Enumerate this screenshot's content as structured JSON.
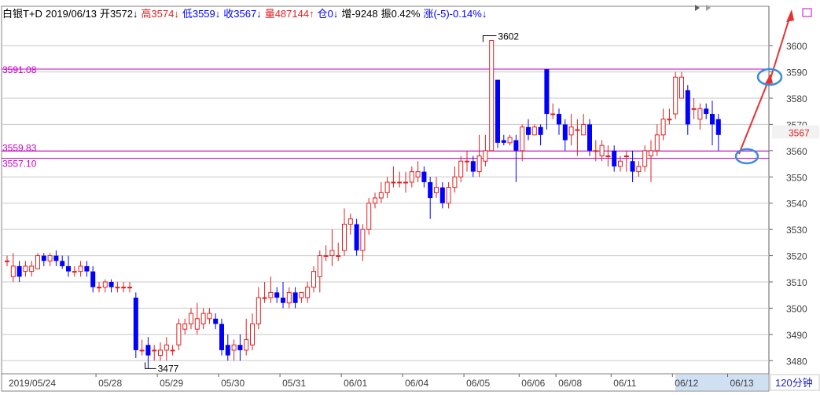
{
  "header": {
    "parts": [
      {
        "text": "白银T+D",
        "color": "#000000"
      },
      {
        "text": "2019/06/13",
        "color": "#000000"
      },
      {
        "text": "开3572↓",
        "color": "#000000"
      },
      {
        "text": "高3574↓",
        "color": "#e02020"
      },
      {
        "text": "低3559↓",
        "color": "#0000ff"
      },
      {
        "text": "收3567↓",
        "color": "#0000ff"
      },
      {
        "text": "量487144↑",
        "color": "#e02020"
      },
      {
        "text": "仓0↓",
        "color": "#0000ff"
      },
      {
        "text": "增-9248",
        "color": "#000000"
      },
      {
        "text": "振0.42%",
        "color": "#000000"
      },
      {
        "text": "涨(-5)-0.14%↓",
        "color": "#0000ff"
      }
    ]
  },
  "period_label": "120分钟",
  "colors": {
    "up": "#e02020",
    "down": "#0000ff",
    "level": "#c800c8",
    "arrow": "#e83030",
    "circle": "#3a8be0",
    "grid": "#c8c8c8",
    "axis": "#808080"
  },
  "chart_data": {
    "type": "candlestick",
    "title": "",
    "ylim": [
      3475,
      3615
    ],
    "y_ticks": [
      3480,
      3490,
      3500,
      3510,
      3520,
      3530,
      3540,
      3550,
      3560,
      3570,
      3580,
      3590,
      3600
    ],
    "x_labels": [
      {
        "label": "2019/05/24",
        "at": 0
      },
      {
        "label": "05/28",
        "at": 14.5
      },
      {
        "label": "05/29",
        "at": 24.5
      },
      {
        "label": "05/30",
        "at": 34.5
      },
      {
        "label": "05/31",
        "at": 44.5
      },
      {
        "label": "06/01",
        "at": 54.5
      },
      {
        "label": "06/04",
        "at": 64.5
      },
      {
        "label": "06/05",
        "at": 74.5
      },
      {
        "label": "06/06",
        "at": 83.5
      },
      {
        "label": "06/08",
        "at": 89.5
      },
      {
        "label": "06/11",
        "at": 98.5
      },
      {
        "label": "06/12",
        "at": 108.5
      },
      {
        "label": "06/13",
        "at": 117.5
      }
    ],
    "horizontal_levels": [
      {
        "value": 3591.08,
        "label": "3591.08"
      },
      {
        "value": 3559.83,
        "label": "3559.83"
      },
      {
        "value": 3557.1,
        "label": "3557.10"
      }
    ],
    "annotations": [
      {
        "text": "3602",
        "value": 3602,
        "at": 78
      },
      {
        "text": "3477",
        "value": 3477,
        "at": 22
      }
    ],
    "last_price": "3567",
    "candles": [
      [
        3518,
        3518,
        3516,
        3520
      ],
      [
        3512,
        3516,
        3510,
        3521
      ],
      [
        3516,
        3512,
        3510,
        3518
      ],
      [
        3514,
        3516,
        3512,
        3518
      ],
      [
        3514,
        3516,
        3512,
        3518
      ],
      [
        3515,
        3520,
        3515,
        3521
      ],
      [
        3520,
        3518,
        3516,
        3521
      ],
      [
        3518,
        3520,
        3516,
        3521
      ],
      [
        3520,
        3518,
        3516,
        3522
      ],
      [
        3518,
        3516,
        3515,
        3520
      ],
      [
        3516,
        3514,
        3512,
        3520
      ],
      [
        3514,
        3514,
        3512,
        3516
      ],
      [
        3514,
        3516,
        3512,
        3518
      ],
      [
        3516,
        3514,
        3512,
        3518
      ],
      [
        3514,
        3508,
        3506,
        3516
      ],
      [
        3508,
        3508,
        3506,
        3510
      ],
      [
        3508,
        3510,
        3506,
        3511
      ],
      [
        3510,
        3508,
        3506,
        3511
      ],
      [
        3508,
        3508,
        3506,
        3510
      ],
      [
        3508,
        3508,
        3506,
        3510
      ],
      [
        3508,
        3508,
        3506,
        3510
      ],
      [
        3504,
        3484,
        3481,
        3506
      ],
      [
        3484,
        3484,
        3482,
        3488
      ],
      [
        3486,
        3482,
        3477,
        3489
      ],
      [
        3484,
        3484,
        3480,
        3486
      ],
      [
        3482,
        3484,
        3480,
        3487
      ],
      [
        3484,
        3486,
        3480,
        3489
      ],
      [
        3484,
        3484,
        3482,
        3486
      ],
      [
        3486,
        3494,
        3484,
        3496
      ],
      [
        3492,
        3494,
        3490,
        3496
      ],
      [
        3494,
        3498,
        3492,
        3500
      ],
      [
        3492,
        3496,
        3490,
        3502
      ],
      [
        3494,
        3498,
        3492,
        3500
      ],
      [
        3496,
        3498,
        3494,
        3500
      ],
      [
        3496,
        3494,
        3492,
        3498
      ],
      [
        3494,
        3484,
        3482,
        3496
      ],
      [
        3486,
        3482,
        3480,
        3490
      ],
      [
        3484,
        3486,
        3480,
        3488
      ],
      [
        3486,
        3484,
        3480,
        3490
      ],
      [
        3484,
        3488,
        3482,
        3496
      ],
      [
        3486,
        3494,
        3484,
        3498
      ],
      [
        3494,
        3504,
        3492,
        3508
      ],
      [
        3504,
        3504,
        3502,
        3510
      ],
      [
        3504,
        3506,
        3502,
        3512
      ],
      [
        3506,
        3504,
        3502,
        3508
      ],
      [
        3504,
        3502,
        3500,
        3510
      ],
      [
        3502,
        3506,
        3500,
        3508
      ],
      [
        3506,
        3502,
        3500,
        3508
      ],
      [
        3504,
        3506,
        3502,
        3506
      ],
      [
        3504,
        3508,
        3502,
        3510
      ],
      [
        3508,
        3514,
        3506,
        3516
      ],
      [
        3512,
        3520,
        3506,
        3522
      ],
      [
        3520,
        3520,
        3518,
        3524
      ],
      [
        3520,
        3522,
        3516,
        3530
      ],
      [
        3520,
        3520,
        3518,
        3525
      ],
      [
        3522,
        3532,
        3520,
        3538
      ],
      [
        3532,
        3534,
        3528,
        3536
      ],
      [
        3532,
        3522,
        3520,
        3534
      ],
      [
        3522,
        3530,
        3518,
        3532
      ],
      [
        3530,
        3540,
        3528,
        3542
      ],
      [
        3540,
        3542,
        3538,
        3544
      ],
      [
        3542,
        3544,
        3540,
        3548
      ],
      [
        3544,
        3548,
        3542,
        3550
      ],
      [
        3548,
        3548,
        3546,
        3554
      ],
      [
        3548,
        3548,
        3546,
        3552
      ],
      [
        3548,
        3548,
        3544,
        3552
      ],
      [
        3548,
        3552,
        3546,
        3554
      ],
      [
        3550,
        3552,
        3548,
        3556
      ],
      [
        3552,
        3548,
        3546,
        3554
      ],
      [
        3548,
        3542,
        3534,
        3550
      ],
      [
        3544,
        3546,
        3542,
        3550
      ],
      [
        3546,
        3540,
        3538,
        3548
      ],
      [
        3540,
        3546,
        3538,
        3548
      ],
      [
        3546,
        3550,
        3544,
        3554
      ],
      [
        3550,
        3556,
        3548,
        3558
      ],
      [
        3556,
        3556,
        3552,
        3560
      ],
      [
        3556,
        3552,
        3550,
        3558
      ],
      [
        3552,
        3558,
        3550,
        3566
      ],
      [
        3556,
        3560,
        3554,
        3566
      ],
      [
        3560,
        3602,
        3560,
        3602
      ],
      [
        3587,
        3563,
        3561,
        3587
      ],
      [
        3564,
        3563,
        3562,
        3566
      ],
      [
        3563,
        3565,
        3562,
        3566
      ],
      [
        3564,
        3560,
        3548,
        3566
      ],
      [
        3560,
        3569,
        3556,
        3570
      ],
      [
        3569,
        3566,
        3564,
        3572
      ],
      [
        3566,
        3569,
        3566,
        3570
      ],
      [
        3569,
        3566,
        3562,
        3570
      ],
      [
        3591,
        3574,
        3568,
        3591
      ],
      [
        3574,
        3574,
        3572,
        3578
      ],
      [
        3574,
        3570,
        3566,
        3576
      ],
      [
        3570,
        3564,
        3560,
        3572
      ],
      [
        3566,
        3569,
        3562,
        3574
      ],
      [
        3568,
        3568,
        3558,
        3572
      ],
      [
        3566,
        3570,
        3566,
        3574
      ],
      [
        3570,
        3560,
        3558,
        3572
      ],
      [
        3560,
        3560,
        3556,
        3564
      ],
      [
        3558,
        3562,
        3556,
        3564
      ],
      [
        3558,
        3558,
        3554,
        3562
      ],
      [
        3560,
        3554,
        3552,
        3562
      ],
      [
        3554,
        3556,
        3552,
        3558
      ],
      [
        3558,
        3558,
        3552,
        3560
      ],
      [
        3556,
        3552,
        3548,
        3560
      ],
      [
        3552,
        3554,
        3550,
        3556
      ],
      [
        3554,
        3560,
        3552,
        3562
      ],
      [
        3558,
        3560,
        3548,
        3564
      ],
      [
        3560,
        3566,
        3558,
        3570
      ],
      [
        3566,
        3572,
        3564,
        3576
      ],
      [
        3572,
        3572,
        3570,
        3576
      ],
      [
        3574,
        3588,
        3572,
        3590
      ],
      [
        3580,
        3588,
        3580,
        3590
      ],
      [
        3583,
        3570,
        3566,
        3585
      ],
      [
        3576,
        3576,
        3572,
        3580
      ],
      [
        3572,
        3576,
        3568,
        3578
      ],
      [
        3576,
        3574,
        3572,
        3578
      ],
      [
        3574,
        3570,
        3562,
        3579
      ],
      [
        3572,
        3566,
        3560,
        3574
      ]
    ]
  }
}
